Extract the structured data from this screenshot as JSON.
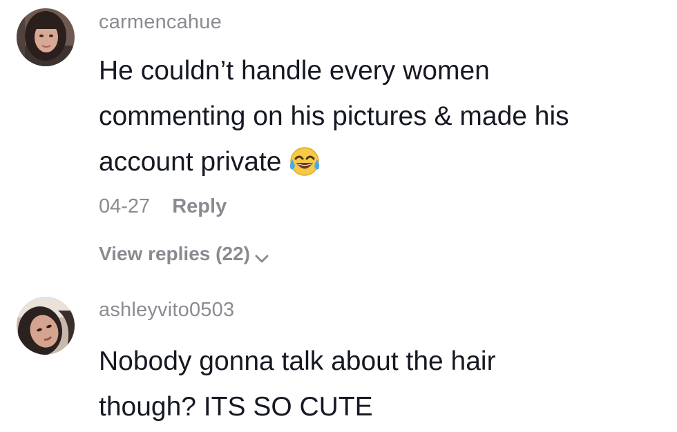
{
  "comments": [
    {
      "username": "carmencahue",
      "text_lines": [
        "He couldn’t handle every women",
        "commenting on his pictures & made his",
        "account private"
      ],
      "emoji": "face-with-tears-of-joy-icon",
      "date": "04-27",
      "reply_label": "Reply",
      "view_replies_label": "View replies (22)"
    },
    {
      "username": "ashleyvito0503",
      "text_lines": [
        "Nobody gonna talk about the hair",
        "though? ITS SO CUTE"
      ]
    }
  ],
  "colors": {
    "text": "#161823",
    "secondary": "#8a8b91",
    "background": "#ffffff"
  }
}
